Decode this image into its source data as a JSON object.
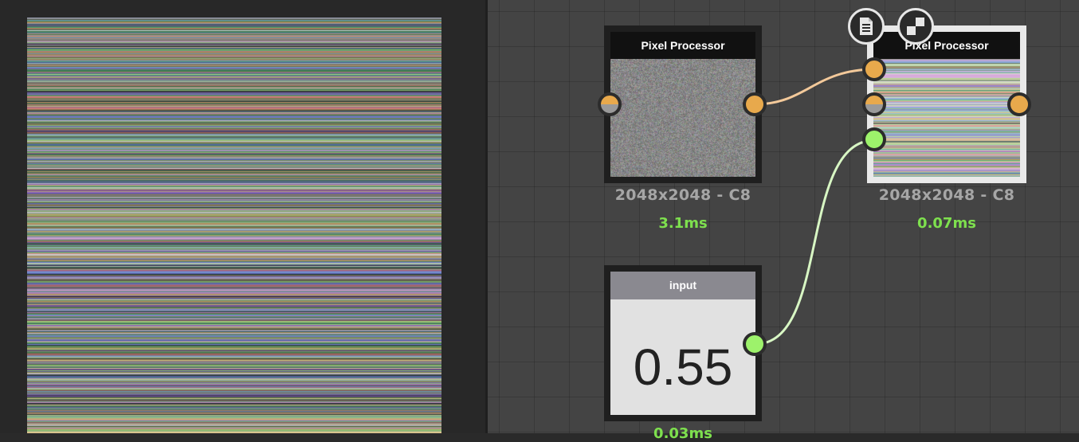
{
  "nodes": {
    "pixel_processor_1": {
      "title": "Pixel Processor",
      "info": "2048x2048 - C8",
      "time": "3.1ms"
    },
    "pixel_processor_2": {
      "title": "Pixel Processor",
      "info": "2048x2048 - C8",
      "time": "0.07ms"
    },
    "input": {
      "title": "input",
      "value": "0.55",
      "time": "0.03ms"
    }
  },
  "node_toolbar": {
    "icons": [
      "document-icon",
      "checkerboard-icon"
    ]
  },
  "colors": {
    "port_orange": "#e8a94c",
    "port_green": "#9df26b",
    "time_green": "#7ee04e",
    "wire_orange": "#f3c99a",
    "wire_green": "#d8f7c4",
    "graph_bg": "#444444"
  }
}
